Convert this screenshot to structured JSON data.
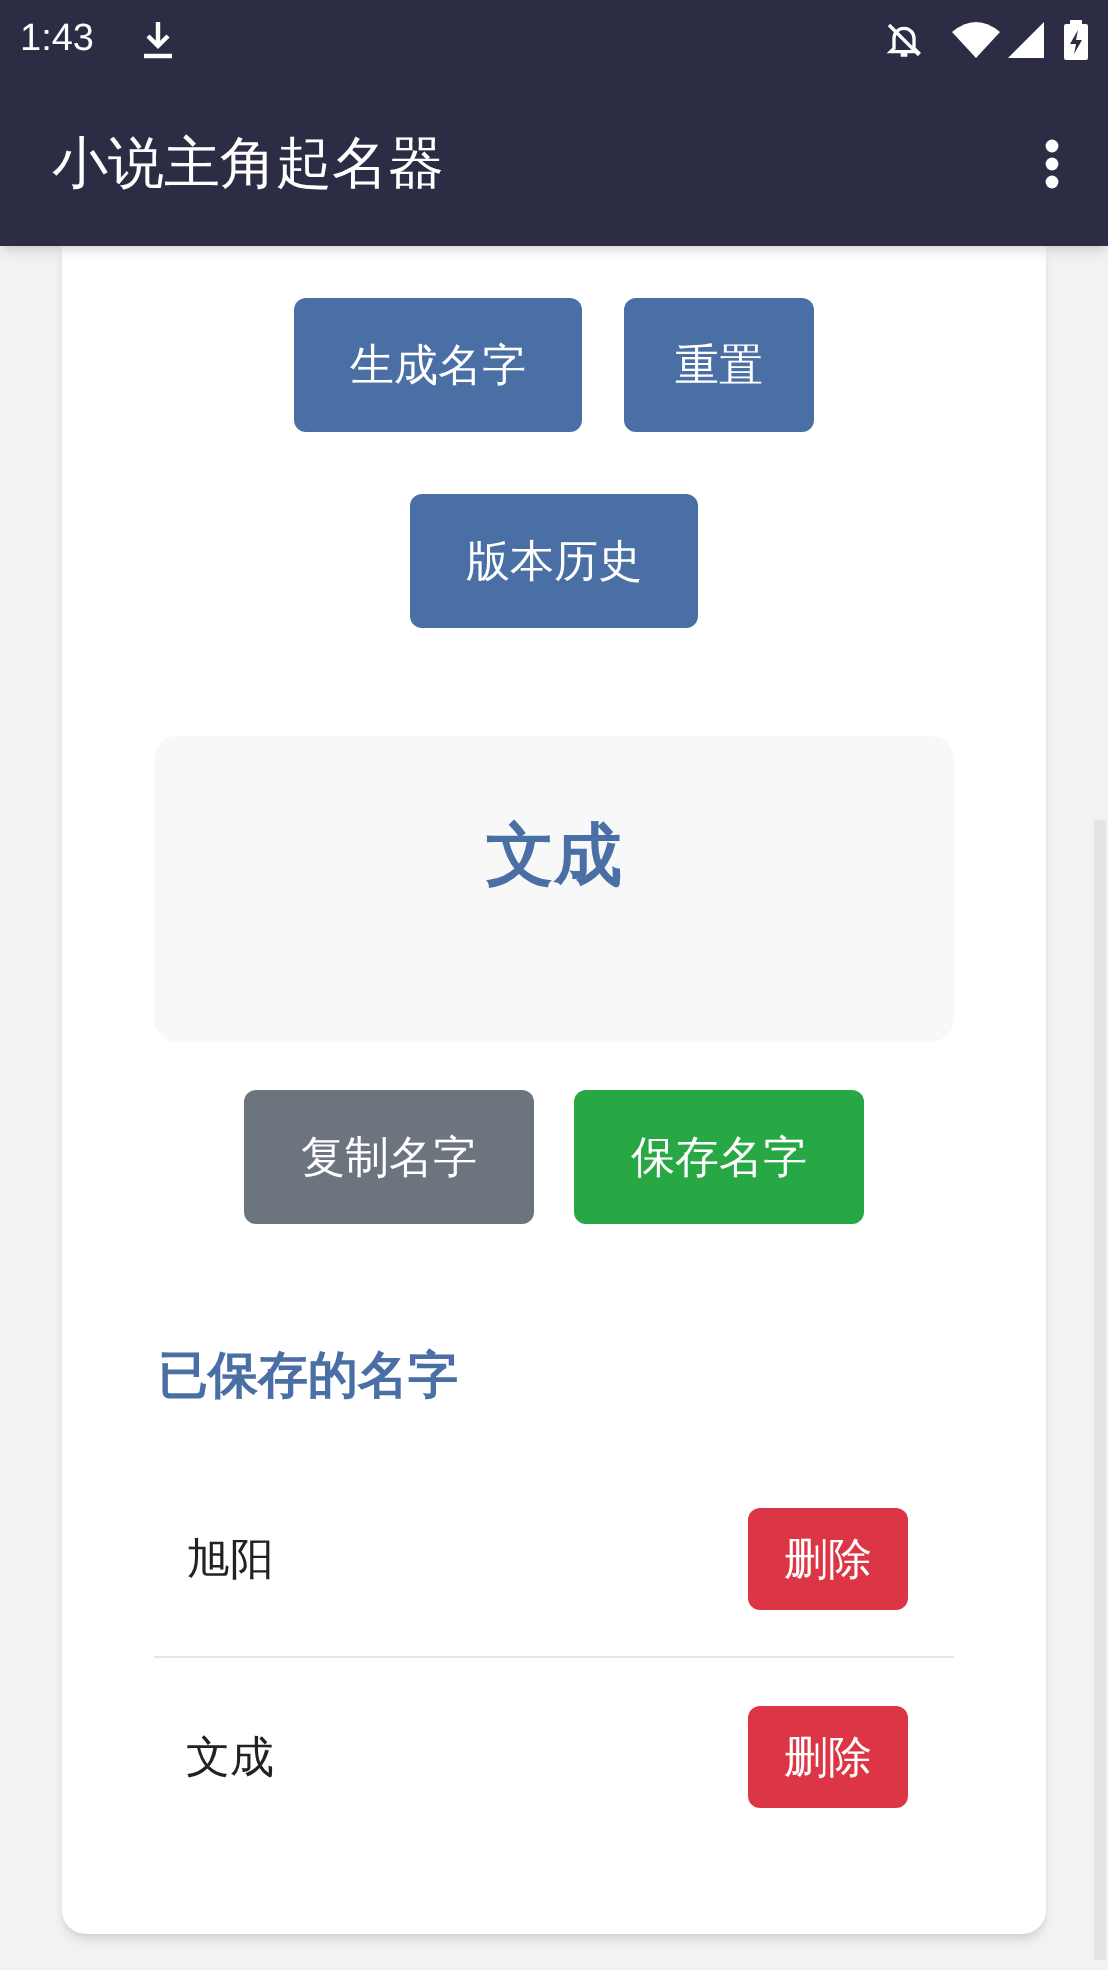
{
  "status_bar": {
    "time": "1:43"
  },
  "app_bar": {
    "title": "小说主角起名器"
  },
  "top_buttons": [
    {
      "label": "生成名字",
      "kind": "primary"
    },
    {
      "label": "重置",
      "kind": "primary"
    }
  ],
  "history_button": {
    "label": "版本历史",
    "kind": "primary"
  },
  "result": {
    "name": "文成"
  },
  "action_buttons": [
    {
      "label": "复制名字",
      "kind": "secondary"
    },
    {
      "label": "保存名字",
      "kind": "success"
    }
  ],
  "saved": {
    "heading": "已保存的名字",
    "items": [
      {
        "name": "旭阳",
        "delete_label": "删除"
      },
      {
        "name": "文成",
        "delete_label": "删除"
      }
    ]
  }
}
